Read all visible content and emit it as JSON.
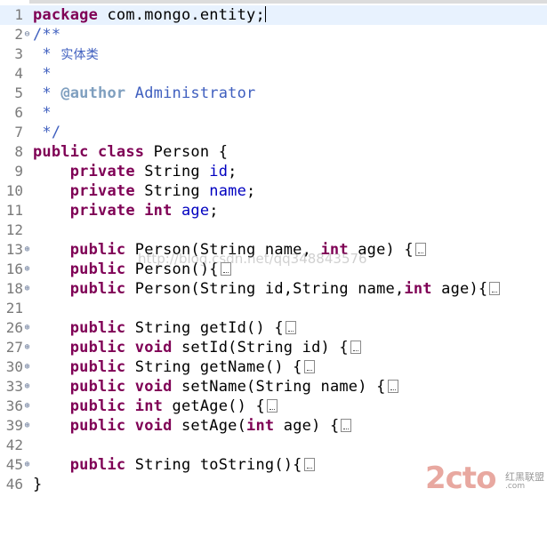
{
  "editor": {
    "lines": [
      {
        "num": "1"
      },
      {
        "num": "2"
      },
      {
        "num": "3"
      },
      {
        "num": "4"
      },
      {
        "num": "5"
      },
      {
        "num": "6"
      },
      {
        "num": "7"
      },
      {
        "num": "8"
      },
      {
        "num": "9"
      },
      {
        "num": "10"
      },
      {
        "num": "11"
      },
      {
        "num": "12"
      },
      {
        "num": "13"
      },
      {
        "num": "16"
      },
      {
        "num": "18"
      },
      {
        "num": "21"
      },
      {
        "num": "26"
      },
      {
        "num": "27"
      },
      {
        "num": "30"
      },
      {
        "num": "33"
      },
      {
        "num": "36"
      },
      {
        "num": "39"
      },
      {
        "num": "42"
      },
      {
        "num": "45"
      },
      {
        "num": "46"
      }
    ],
    "tokens": {
      "package": "package",
      "package_name": " com.mongo.entity;",
      "comment_open": "/**",
      "comment_star": " * ",
      "comment_desc": "实体类",
      "comment_star_only": " *",
      "author_tag": "@author",
      "author_name": " Administrator",
      "comment_close": " */",
      "public": "public",
      "private": "private",
      "class": "class",
      "void": "void",
      "int": "int",
      "class_decl": " Person {",
      "field_string": " String ",
      "field_id": "id",
      "field_name": "name",
      "field_age": "age",
      "semicolon": ";",
      "ctor1_a": " Person(String name, ",
      "ctor1_b": " age) {",
      "ctor2": " Person(){",
      "ctor3_a": " Person(String id,String name,",
      "ctor3_b": " age){",
      "get_id": " String getId() {",
      "set_id": " setId(String id) {",
      "get_name": " String getName() {",
      "set_name": " setName(String name) {",
      "get_age": " getAge() {",
      "set_age_a": " setAge(",
      "set_age_b": " age) {",
      "to_string": " String toString(){",
      "close_brace": "}"
    },
    "fold_markers": {
      "collapsed": "⊕",
      "expanded": "⊖"
    }
  },
  "watermark": {
    "text": "http://blog.csdn.net/qq348843576"
  },
  "logo": {
    "brand": "2cto",
    "dot_com": ".com",
    "sub": "红黑联盟"
  }
}
